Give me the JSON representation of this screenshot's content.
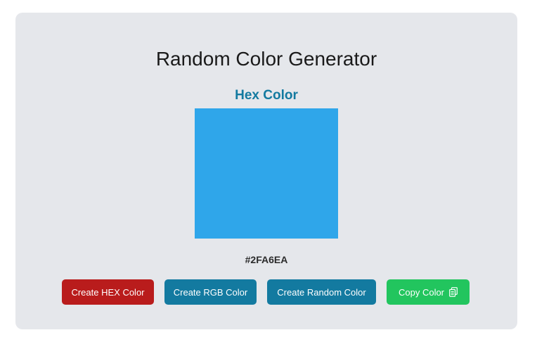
{
  "app": {
    "title": "Random Color Generator",
    "subtitle": "Hex Color"
  },
  "swatch": {
    "color": "#2FA6EA",
    "label": "#2FA6EA"
  },
  "buttons": {
    "hex": {
      "label": "Create HEX Color",
      "color": "#b91c1c"
    },
    "rgb": {
      "label": "Create RGB Color",
      "color": "#137aa0"
    },
    "random": {
      "label": "Create Random Color",
      "color": "#137aa0"
    },
    "copy": {
      "label": "Copy Color",
      "color": "#22c55e",
      "icon": "copy-icon"
    }
  }
}
